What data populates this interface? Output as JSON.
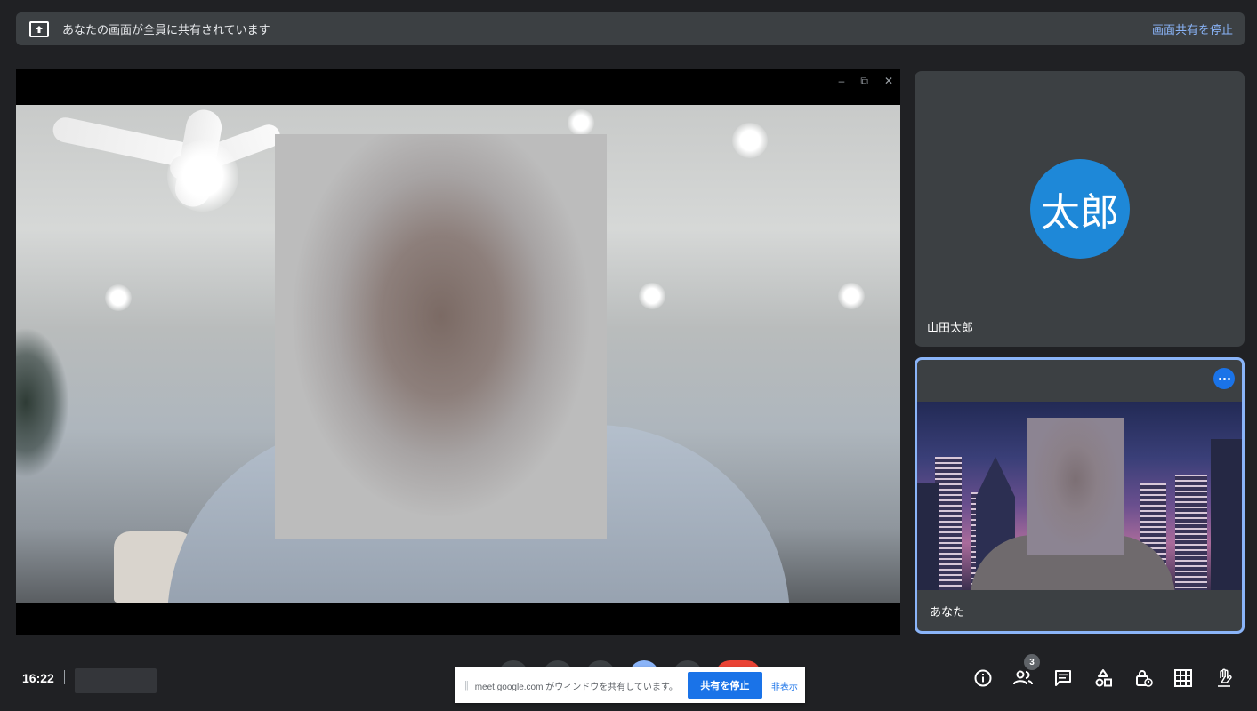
{
  "banner": {
    "text": "あなたの画面が全員に共有されています",
    "stop_label": "画面共有を停止"
  },
  "main_tile": {
    "window_controls": [
      "–",
      "⧉",
      "✕"
    ]
  },
  "participants": [
    {
      "name": "山田太郎",
      "initials": "太郎",
      "avatar_color": "#1e88d8"
    },
    {
      "name": "あなた"
    }
  ],
  "bottom_bar": {
    "time": "16:22",
    "people_count": "3"
  },
  "share_toast": {
    "message": "meet.google.com がウィンドウを共有しています。",
    "stop_label": "共有を停止",
    "hide_label": "非表示"
  },
  "colors": {
    "accent": "#8ab4f8",
    "primary_blue": "#1a73e8",
    "end_call_red": "#ea4335",
    "tile_bg": "#3c4043"
  }
}
